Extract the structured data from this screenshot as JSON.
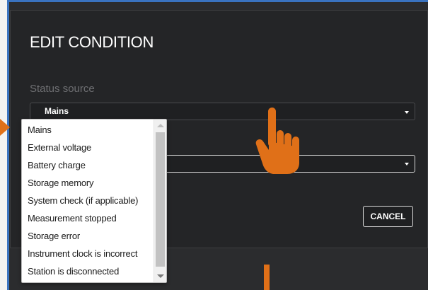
{
  "dialog": {
    "title": "EDIT CONDITION",
    "status_source_label": "Status source",
    "status_source_value": "Mains",
    "cancel_label": "CANCEL"
  },
  "dropdown": {
    "items": [
      "Mains",
      "External voltage",
      "Battery charge",
      "Storage memory",
      "System check (if applicable)",
      "Measurement stopped",
      "Storage error",
      "Instrument clock is incorrect",
      "Station is disconnected"
    ]
  },
  "colors": {
    "annotation_orange": "#e07018",
    "dialog_background": "#242527",
    "frame_blue": "#3a73c0"
  },
  "icons": {
    "pointer": "hand-pointer-icon",
    "caret": "chevron-down-icon"
  }
}
